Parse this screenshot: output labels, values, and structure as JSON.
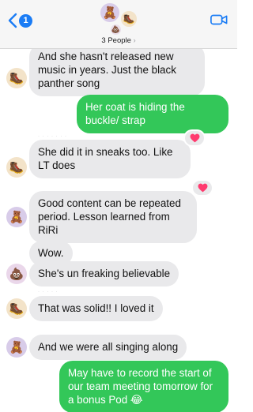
{
  "header": {
    "back_badge": "1",
    "participants_label": "3 People",
    "chevron_glyph": "›",
    "avatars": [
      "🧸",
      "🥾",
      "💩"
    ]
  },
  "messages": [
    {
      "direction": "in",
      "avatar": "🥾",
      "text": "And she hasn't released new music in years. Just the black panther song"
    },
    {
      "direction": "out",
      "text": "Her coat is hiding the buckle/ strap"
    },
    {
      "direction": "in",
      "avatar": "🥾",
      "text": "She did it in sneaks too. Like LT does",
      "tapback": "heart"
    },
    {
      "direction": "in",
      "avatar": "🧸",
      "text": "Good content can be repeated period. Lesson learned from RiRi",
      "tapback": "heart"
    },
    {
      "direction": "in",
      "text": "Wow."
    },
    {
      "direction": "in",
      "avatar": "💩",
      "text": "She's un freaking believable"
    },
    {
      "direction": "in",
      "avatar": "🥾",
      "text": "That was solid!! I loved it"
    },
    {
      "direction": "in",
      "avatar": "🧸",
      "text": "And we were all singing along"
    },
    {
      "direction": "out",
      "text": "May have to record the start of our team meeting tomorrow for a bonus Pod 😂"
    }
  ],
  "colors": {
    "incoming_bubble": "#e9e9eb",
    "outgoing_bubble": "#33c759",
    "accent": "#1a7cf5",
    "tapback_heart": "#ff3b6f"
  },
  "icons": {
    "back": "chevron-left-icon",
    "video": "video-camera-icon",
    "tapback": "heart-icon"
  }
}
